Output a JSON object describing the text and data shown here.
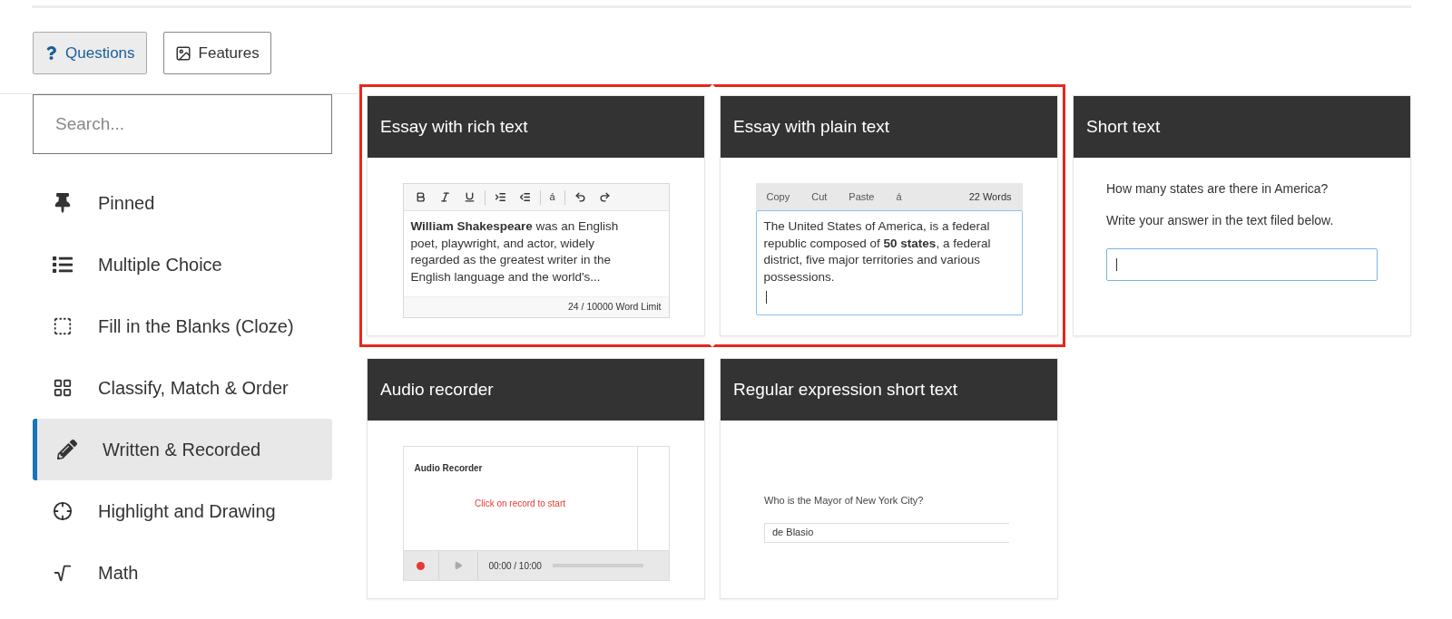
{
  "tabs": [
    {
      "label": "Questions",
      "selected": true
    },
    {
      "label": "Features",
      "selected": false
    }
  ],
  "search": {
    "placeholder": "Search..."
  },
  "sidebar": {
    "items": [
      {
        "label": "Pinned",
        "selected": false
      },
      {
        "label": "Multiple Choice",
        "selected": false
      },
      {
        "label": "Fill in the Blanks (Cloze)",
        "selected": false
      },
      {
        "label": "Classify, Match & Order",
        "selected": false
      },
      {
        "label": "Written & Recorded",
        "selected": true
      },
      {
        "label": "Highlight and Drawing",
        "selected": false
      },
      {
        "label": "Math",
        "selected": false
      }
    ]
  },
  "cards": [
    {
      "kind": "rich_essay",
      "title": "Essay with rich text",
      "highlighted": true,
      "toolbar_char": "á",
      "text": "**William Shakespeare** was an English poet, playwright, and actor, widely regarded as the greatest writer in the English language and the world's...",
      "footer": "24 / 10000 Word Limit"
    },
    {
      "kind": "plain_essay",
      "title": "Essay with plain text",
      "highlighted": true,
      "toolbar": [
        "Copy",
        "Cut",
        "Paste",
        "á"
      ],
      "count": "22 Words",
      "text": "The United States of America, is a federal republic composed of **50 states**, a federal district, five major territories and various possessions."
    },
    {
      "kind": "short_text",
      "title": "Short text",
      "highlighted": false,
      "lines": [
        "How many states are there in America?",
        "Write your answer in the text filed below."
      ]
    },
    {
      "kind": "audio",
      "title": "Audio recorder",
      "highlighted": false,
      "heading": "Audio Recorder",
      "message": "Click on record to start",
      "time": "00:00 / 10:00"
    },
    {
      "kind": "regex",
      "title": "Regular expression short text",
      "highlighted": false,
      "question": "Who is the Mayor of New York City?",
      "value": "de Blasio"
    }
  ]
}
